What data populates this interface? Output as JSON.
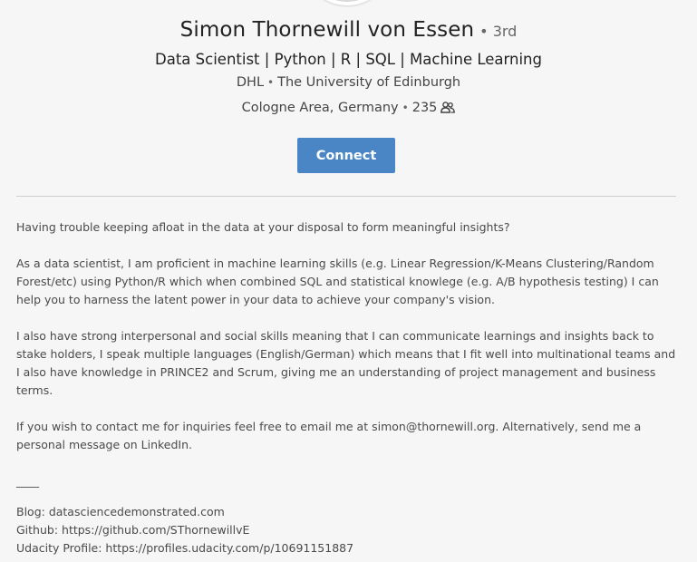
{
  "profile": {
    "name": "Simon Thornewill von Essen",
    "degree": "3rd",
    "headline": "Data Scientist | Python | R | SQL | Machine Learning",
    "company": "DHL",
    "school": "The University of Edinburgh",
    "location": "Cologne Area, Germany",
    "connections": "235",
    "separator": "•",
    "connections_icon": "people-icon"
  },
  "actions": {
    "connect_label": "Connect"
  },
  "colors": {
    "accent": "#4a86c5",
    "background": "#f6f6f6",
    "text": "#4a4a4a"
  },
  "summary": {
    "paragraphs": [
      "Having trouble keeping afloat in the data at your disposal to form meaningful insights?",
      "As a data scientist, I am proficient in machine learning skills (e.g. Linear Regression/K-Means Clustering/Random Forest/etc) using Python/R which when combined SQL and statistical knowlege (e.g. A/B hypothesis testing) I can help you to harness the latent power in your data to achieve your company's vision.",
      "I also have strong interpersonal and social skills meaning that I can communicate learnings and insights back to stake holders, I speak multiple languages (English/German) which means that I fit well into multinational teams and I also have knowledge in PRINCE2 and Scrum, giving me an understanding of project management and business terms.",
      "If you wish to contact me for inquiries feel free to email me at simon@thornewill.org. Alternatively, send me a personal message on LinkedIn."
    ],
    "rule": "____",
    "links": [
      "Blog: datasciencedemonstrated.com",
      "Github: https://github.com/SThornewillvE",
      "Udacity Profile: https://profiles.udacity.com/p/10691151887"
    ]
  }
}
